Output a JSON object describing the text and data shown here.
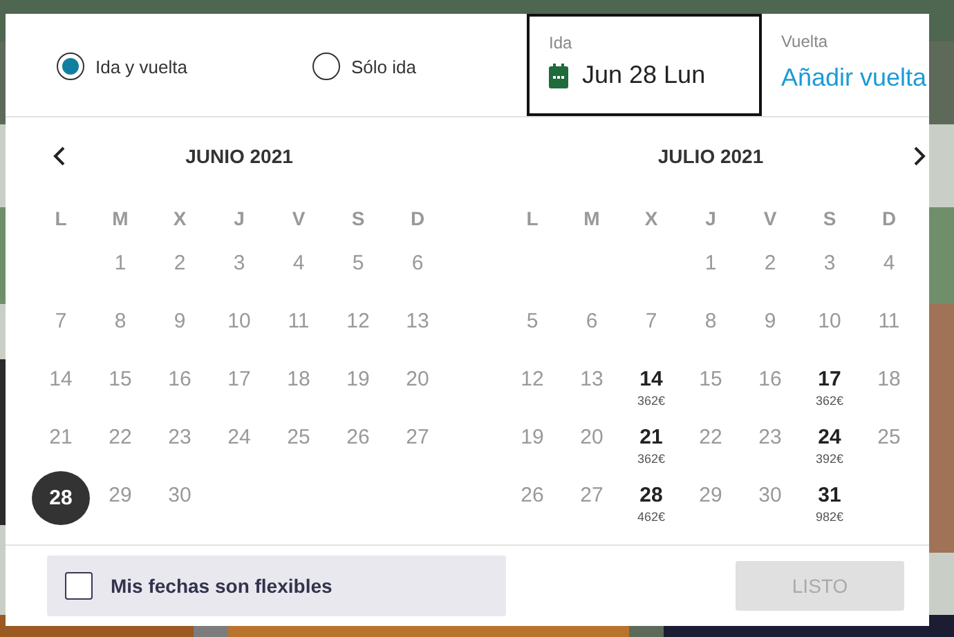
{
  "trip_type": [
    {
      "label": "Ida y vuelta",
      "selected": true
    },
    {
      "label": "Sólo ida",
      "selected": false
    }
  ],
  "departure": {
    "label": "Ida",
    "value": "Jun 28 Lun"
  },
  "return": {
    "label": "Vuelta",
    "value": "Añadir vuelta"
  },
  "months": [
    {
      "title": "JUNIO 2021",
      "weekdays": [
        "L",
        "M",
        "X",
        "J",
        "V",
        "S",
        "D"
      ],
      "weeks": [
        {
          "kind": "lead",
          "days": [
            {
              "day": "1",
              "available": false,
              "selected": false
            },
            {
              "day": "2",
              "available": false,
              "selected": false
            },
            {
              "day": "3",
              "available": false,
              "selected": false
            },
            {
              "day": "4",
              "available": false,
              "selected": false
            },
            {
              "day": "5",
              "available": false,
              "selected": false
            },
            {
              "day": "6",
              "available": false,
              "selected": false
            }
          ]
        },
        {
          "kind": "full",
          "days": [
            {
              "day": "7",
              "available": false,
              "selected": false
            },
            {
              "day": "8",
              "available": false,
              "selected": false
            },
            {
              "day": "9",
              "available": false,
              "selected": false
            },
            {
              "day": "10",
              "available": false,
              "selected": false
            },
            {
              "day": "11",
              "available": false,
              "selected": false
            },
            {
              "day": "12",
              "available": false,
              "selected": false
            },
            {
              "day": "13",
              "available": false,
              "selected": false
            }
          ]
        },
        {
          "kind": "full",
          "days": [
            {
              "day": "14",
              "available": false,
              "selected": false
            },
            {
              "day": "15",
              "available": false,
              "selected": false
            },
            {
              "day": "16",
              "available": false,
              "selected": false
            },
            {
              "day": "17",
              "available": false,
              "selected": false
            },
            {
              "day": "18",
              "available": false,
              "selected": false
            },
            {
              "day": "19",
              "available": false,
              "selected": false
            },
            {
              "day": "20",
              "available": false,
              "selected": false
            }
          ]
        },
        {
          "kind": "full",
          "days": [
            {
              "day": "21",
              "available": false,
              "selected": false
            },
            {
              "day": "22",
              "available": false,
              "selected": false
            },
            {
              "day": "23",
              "available": false,
              "selected": false
            },
            {
              "day": "24",
              "available": false,
              "selected": false
            },
            {
              "day": "25",
              "available": false,
              "selected": false
            },
            {
              "day": "26",
              "available": false,
              "selected": false
            },
            {
              "day": "27",
              "available": false,
              "selected": false
            }
          ]
        },
        {
          "kind": "trail",
          "days": [
            {
              "day": "28",
              "available": true,
              "selected": true
            },
            {
              "day": "29",
              "available": false,
              "selected": false
            },
            {
              "day": "30",
              "available": false,
              "selected": false
            }
          ]
        }
      ]
    },
    {
      "title": "JULIO 2021",
      "weekdays": [
        "L",
        "M",
        "X",
        "J",
        "V",
        "S",
        "D"
      ],
      "weeks": [
        {
          "kind": "lead",
          "days": [
            {
              "day": "1",
              "available": false,
              "selected": false
            },
            {
              "day": "2",
              "available": false,
              "selected": false
            },
            {
              "day": "3",
              "available": false,
              "selected": false
            },
            {
              "day": "4",
              "available": false,
              "selected": false
            }
          ]
        },
        {
          "kind": "full",
          "days": [
            {
              "day": "5",
              "available": false,
              "selected": false
            },
            {
              "day": "6",
              "available": false,
              "selected": false
            },
            {
              "day": "7",
              "available": false,
              "selected": false
            },
            {
              "day": "8",
              "available": false,
              "selected": false
            },
            {
              "day": "9",
              "available": false,
              "selected": false
            },
            {
              "day": "10",
              "available": false,
              "selected": false
            },
            {
              "day": "11",
              "available": false,
              "selected": false
            }
          ]
        },
        {
          "kind": "full",
          "days": [
            {
              "day": "12",
              "available": false,
              "selected": false
            },
            {
              "day": "13",
              "available": false,
              "selected": false
            },
            {
              "day": "14",
              "available": true,
              "selected": false,
              "price": "362€"
            },
            {
              "day": "15",
              "available": false,
              "selected": false
            },
            {
              "day": "16",
              "available": false,
              "selected": false
            },
            {
              "day": "17",
              "available": true,
              "selected": false,
              "price": "362€"
            },
            {
              "day": "18",
              "available": false,
              "selected": false
            }
          ]
        },
        {
          "kind": "full",
          "days": [
            {
              "day": "19",
              "available": false,
              "selected": false
            },
            {
              "day": "20",
              "available": false,
              "selected": false
            },
            {
              "day": "21",
              "available": true,
              "selected": false,
              "price": "362€"
            },
            {
              "day": "22",
              "available": false,
              "selected": false
            },
            {
              "day": "23",
              "available": false,
              "selected": false
            },
            {
              "day": "24",
              "available": true,
              "selected": false,
              "price": "392€"
            },
            {
              "day": "25",
              "available": false,
              "selected": false
            }
          ]
        },
        {
          "kind": "trail",
          "days": [
            {
              "day": "26",
              "available": false,
              "selected": false
            },
            {
              "day": "27",
              "available": false,
              "selected": false
            },
            {
              "day": "28",
              "available": true,
              "selected": false,
              "price": "462€"
            },
            {
              "day": "29",
              "available": false,
              "selected": false
            },
            {
              "day": "30",
              "available": false,
              "selected": false
            },
            {
              "day": "31",
              "available": true,
              "selected": false,
              "price": "982€"
            }
          ]
        }
      ]
    }
  ],
  "flexible": {
    "label": "Mis fechas son flexibles",
    "checked": false
  },
  "done_button": {
    "label": "LISTO",
    "disabled": true
  }
}
